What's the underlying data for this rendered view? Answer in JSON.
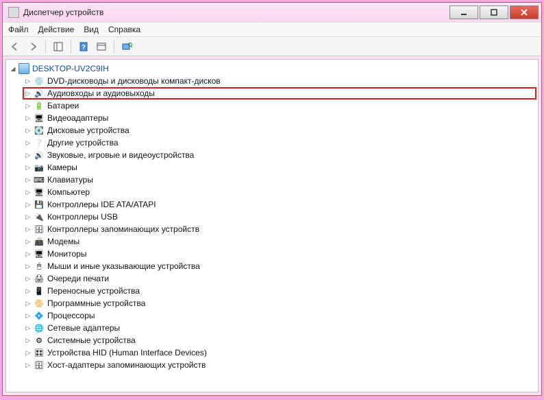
{
  "title": "Диспетчер устройств",
  "menus": [
    "Файл",
    "Действие",
    "Вид",
    "Справка"
  ],
  "computer_name": "DESKTOP-UV2C9IH",
  "highlighted_index": 1,
  "categories": [
    {
      "label": "DVD-дисководы и дисководы компакт-дисков",
      "icon": "💿"
    },
    {
      "label": "Аудиовходы и аудиовыходы",
      "icon": "🔊"
    },
    {
      "label": "Батареи",
      "icon": "🔋"
    },
    {
      "label": "Видеоадаптеры",
      "icon": "🖥"
    },
    {
      "label": "Дисковые устройства",
      "icon": "💽"
    },
    {
      "label": "Другие устройства",
      "icon": "❔"
    },
    {
      "label": "Звуковые, игровые и видеоустройства",
      "icon": "🔊"
    },
    {
      "label": "Камеры",
      "icon": "📷"
    },
    {
      "label": "Клавиатуры",
      "icon": "⌨"
    },
    {
      "label": "Компьютер",
      "icon": "🖥"
    },
    {
      "label": "Контроллеры IDE ATA/ATAPI",
      "icon": "💾"
    },
    {
      "label": "Контроллеры USB",
      "icon": "🔌"
    },
    {
      "label": "Контроллеры запоминающих устройств",
      "icon": "🗄"
    },
    {
      "label": "Модемы",
      "icon": "📠"
    },
    {
      "label": "Мониторы",
      "icon": "🖥"
    },
    {
      "label": "Мыши и иные указывающие устройства",
      "icon": "🖱"
    },
    {
      "label": "Очереди печати",
      "icon": "🖨"
    },
    {
      "label": "Переносные устройства",
      "icon": "📱"
    },
    {
      "label": "Программные устройства",
      "icon": "📀"
    },
    {
      "label": "Процессоры",
      "icon": "💠"
    },
    {
      "label": "Сетевые адаптеры",
      "icon": "🌐"
    },
    {
      "label": "Системные устройства",
      "icon": "⚙"
    },
    {
      "label": "Устройства HID (Human Interface Devices)",
      "icon": "🎛"
    },
    {
      "label": "Хост-адаптеры запоминающих устройств",
      "icon": "🗄"
    }
  ]
}
